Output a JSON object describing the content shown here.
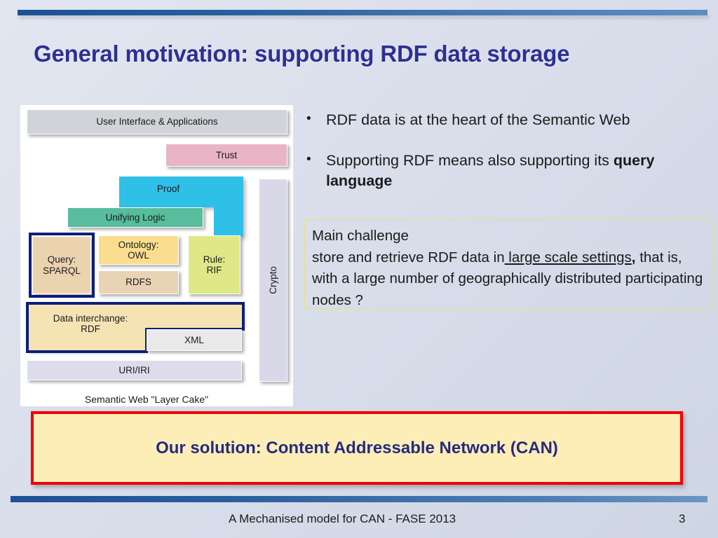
{
  "slide": {
    "title": "General motivation: supporting RDF data storage",
    "background_color": "#dde2ee",
    "accent_color": "#2d3091"
  },
  "bullets": [
    {
      "marker": "•",
      "text": "RDF data is at the heart of the Semantic Web",
      "bold_tail": ""
    },
    {
      "marker": "•",
      "text": "Supporting RDF means also supporting its ",
      "bold_tail": "query language"
    }
  ],
  "challenge": {
    "heading": "Main challenge",
    "line2_pre": "store and retrieve RDF data in",
    "line2_underlined": " large scale settings",
    "line2_post": ", that is, with a large number of geographically distributed participating nodes ?",
    "border_color": "#e8e27a"
  },
  "solution": {
    "text": "Our solution: Content Addressable Network (CAN)",
    "fill_color": "#fdeeb8",
    "border_color": "#f00000",
    "text_color": "#262a80"
  },
  "figure": {
    "caption": "Semantic Web \"Layer Cake\"",
    "highlight_color": "#0b1f7a",
    "blocks": [
      {
        "id": "ui",
        "label": "User Interface & Applications",
        "color": "#d2d3d8"
      },
      {
        "id": "trust",
        "label": "Trust",
        "color": "#e8b4c6"
      },
      {
        "id": "proof",
        "label": "Proof",
        "color": "#2fc0e8"
      },
      {
        "id": "unifying-logic",
        "label": "Unifying Logic",
        "color": "#57bd9c"
      },
      {
        "id": "query-sparql",
        "label": "Query:\nSPARQL",
        "color": "#ecd3b0",
        "highlighted": true
      },
      {
        "id": "ontology-owl",
        "label": "Ontology:\nOWL",
        "color": "#fadd8e"
      },
      {
        "id": "rdfs",
        "label": "RDFS",
        "color": "#e9d3b5"
      },
      {
        "id": "rule-rif",
        "label": "Rule:\nRIF",
        "color": "#dfe886"
      },
      {
        "id": "crypto",
        "label": "Crypto",
        "color": "#d8d8e8"
      },
      {
        "id": "data-interchange-rdf",
        "label": "Data interchange:\nRDF",
        "color": "#f5e3b4",
        "highlighted": true
      },
      {
        "id": "xml",
        "label": "XML",
        "color": "#e9e9ea"
      },
      {
        "id": "uri-iri",
        "label": "URI/IRI",
        "color": "#dcdcec"
      }
    ]
  },
  "footer": {
    "text": "A Mechanised model for CAN - FASE 2013",
    "page": "3"
  }
}
